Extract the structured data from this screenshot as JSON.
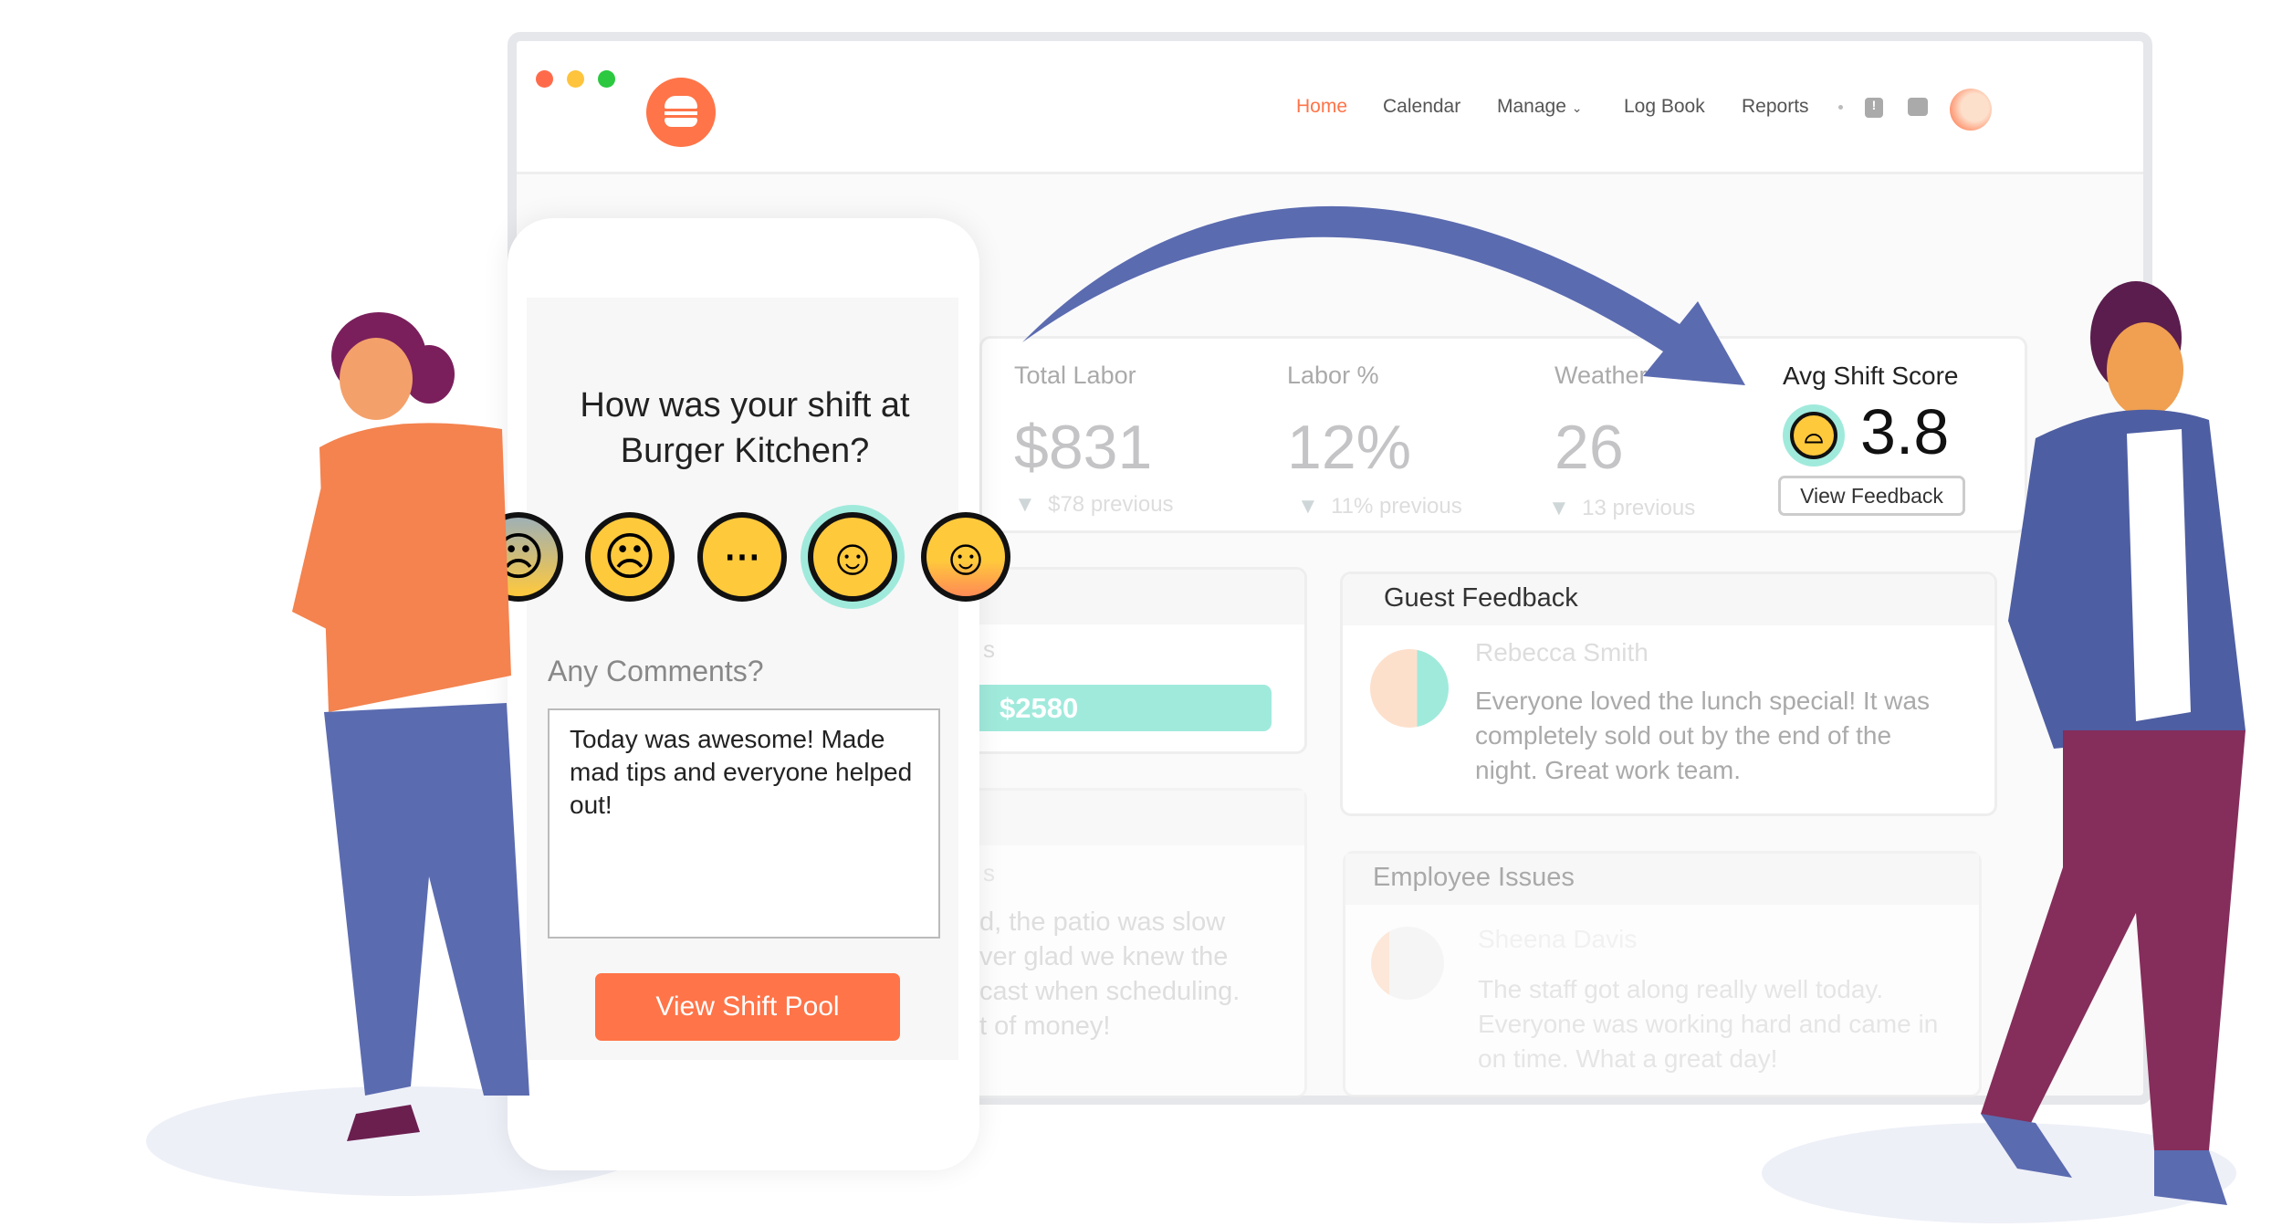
{
  "nav": {
    "items": [
      "Home",
      "Calendar",
      "Manage",
      "Log Book",
      "Reports"
    ],
    "active": "Home"
  },
  "stats": {
    "total_labor": {
      "label": "Total Labor",
      "value": "$831",
      "previous": "$78 previous"
    },
    "labor_pct": {
      "label": "Labor %",
      "value": "12%",
      "previous": "11% previous"
    },
    "weather": {
      "label": "Weather",
      "value": "26",
      "previous": "13 previous"
    },
    "avg_shift_score": {
      "label": "Avg Shift Score",
      "value": "3.8",
      "button": "View Feedback"
    }
  },
  "sales_bar": {
    "value": "$2580",
    "partial_label": "s"
  },
  "notes_partial": {
    "label": "s",
    "lines": [
      "d, the patio was slow",
      "ver glad we knew the",
      "cast when scheduling.",
      "t of money!"
    ]
  },
  "guest_feedback": {
    "title": "Guest Feedback",
    "name": "Rebecca Smith",
    "text": "Everyone loved the lunch special! It was completely sold out by the end of the night. Great work team."
  },
  "employee_issues": {
    "title": "Employee Issues",
    "name": "Sheena Davis",
    "text": "The staff got along really well today. Everyone was working hard and came in on time. What a great day!"
  },
  "phone": {
    "question": "How was your shift at Burger Kitchen?",
    "ratings": [
      "fearful",
      "sad",
      "neutral",
      "happy",
      "grinning"
    ],
    "selected_rating": "happy",
    "comments_label": "Any Comments?",
    "comment": "Today was awesome! Made mad tips and everyone helped out!",
    "button": "View Shift Pool"
  },
  "colors": {
    "brand": "#ff7448",
    "accent": "#a0eadc",
    "arrow": "#5b6bb0"
  }
}
